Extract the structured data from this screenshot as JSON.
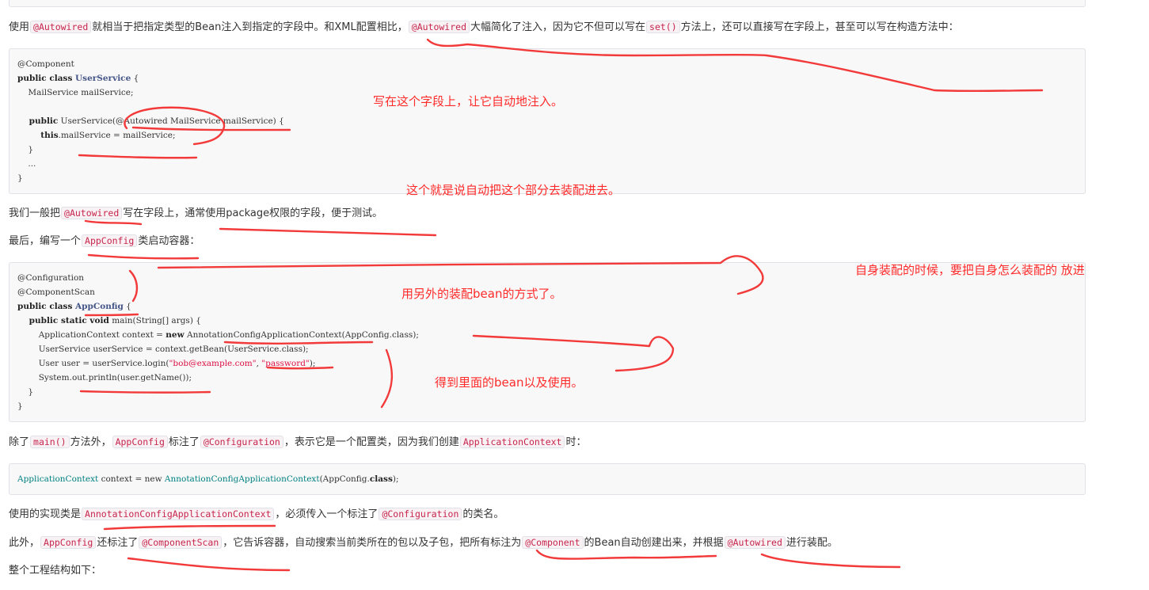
{
  "paragraphs": {
    "p1": {
      "a": "使用",
      "c1": "@Autowired",
      "b": "就相当于把指定类型的Bean注入到指定的字段中。和XML配置相比，",
      "c2": "@Autowired",
      "d": "大幅简化了注入，因为它不但可以写在",
      "c3": "set()",
      "e": "方法上，还可以直接写在字段上，甚至可以写在构造方法中："
    },
    "p2": {
      "a": "我们一般把",
      "c1": "@Autowired",
      "b": "写在字段上，通常使用package权限的字段，便于测试。"
    },
    "p3": {
      "a": "最后，编写一个",
      "c1": "AppConfig",
      "b": "类启动容器："
    },
    "p4": {
      "a": "除了",
      "c1": "main()",
      "b": "方法外，",
      "c2": "AppConfig",
      "d": "标注了",
      "c3": "@Configuration",
      "e": "，表示它是一个配置类，因为我们创建",
      "c4": "ApplicationContext",
      "f": "时："
    },
    "p5": {
      "a": "使用的实现类是",
      "c1": "AnnotationConfigApplicationContext",
      "b": "，必须传入一个标注了",
      "c2": "@Configuration",
      "d": "的类名。"
    },
    "p6": {
      "a": "此外，",
      "c1": "AppConfig",
      "b": "还标注了",
      "c2": "@ComponentScan",
      "d": "，它告诉容器，自动搜索当前类所在的包以及子包，把所有标注为",
      "c3": "@Component",
      "e": "的Bean自动创建出来，并根据",
      "c4": "@Autowired",
      "f": "进行装配。"
    },
    "p7": {
      "a": "整个工程结构如下："
    }
  },
  "code1": {
    "l1": "@Component",
    "l2_kw": "public class ",
    "l2_ty": "UserService",
    "l2_rest": " {",
    "l3": "    MailService mailService;",
    "l5_kw": "    public",
    "l5_rest": " UserService(@Autowired MailService mailService) {",
    "l6_kw": "        this",
    "l6_rest": ".mailService = mailService;",
    "l7": "    }",
    "l8": "    ...",
    "l9": "}"
  },
  "code2": {
    "l1": "@Configuration",
    "l2": "@ComponentScan",
    "l3_kw": "public class ",
    "l3_ty": "AppConfig",
    "l3_rest": " {",
    "l4_kw": "    public static void",
    "l4_rest": " main(String[] args) {",
    "l5_a": "        ApplicationContext context = ",
    "l5_kw": "new",
    "l5_b": " AnnotationConfigApplicationContext(AppConfig.class);",
    "l6": "        UserService userService = context.getBean(UserService.class);",
    "l7_a": "        User user = userService.login(",
    "l7_s1": "\"bob@example.com\"",
    "l7_m": ", ",
    "l7_s2": "\"password\"",
    "l7_b": ");",
    "l8": "        System.out.println(user.getName());",
    "l9": "    }",
    "l10": "}"
  },
  "code3": {
    "a": "ApplicationContext",
    "b": " context = new ",
    "c": "AnnotationConfigApplicationContext",
    "d": "(AppConfig.",
    "e": "class",
    "f": ");"
  },
  "notes": {
    "n1": "写在这个字段上，让它自动地注入。",
    "n2": "这个就是说自动把这个部分去装配进去。",
    "n3": "自身装配的时候，要把自身怎么装配的 放进",
    "n4": "用另外的装配bean的方式了。",
    "n5": "得到里面的bean以及使用。"
  },
  "colors": {
    "annotation": "#ff2a2a",
    "inline_code": "#c7254e",
    "code_bg": "#f8f8f8"
  }
}
